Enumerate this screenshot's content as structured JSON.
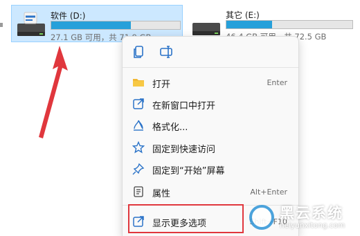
{
  "drives": [
    {
      "name": "软件 (D:)",
      "size_text": "27.1 GB 可用，共 71.9 GB",
      "used_fraction": 0.62
    },
    {
      "name": "其它 (E:)",
      "size_text": "46.4 GB 可用，共 72.5 GB",
      "used_fraction": 0.36
    }
  ],
  "context_menu": {
    "quick_actions": [
      "copy-icon",
      "rename-icon"
    ],
    "items": [
      {
        "label": "打开",
        "shortcut": "Enter",
        "icon": "folder-icon"
      },
      {
        "label": "在新窗口中打开",
        "shortcut": "",
        "icon": "open-new-window-icon"
      },
      {
        "label": "格式化...",
        "shortcut": "",
        "icon": "format-icon"
      },
      {
        "label": "固定到快速访问",
        "shortcut": "",
        "icon": "star-icon"
      },
      {
        "label": "固定到“开始”屏幕",
        "shortcut": "",
        "icon": "pin-icon"
      },
      {
        "label": "属性",
        "shortcut": "Alt+Enter",
        "icon": "properties-icon"
      },
      {
        "label": "显示更多选项",
        "shortcut": "Shift+F10",
        "icon": "more-options-icon"
      }
    ]
  },
  "watermark": {
    "title": "黑云系统",
    "url": "heiyunxitong.com"
  },
  "colors": {
    "selection": "#cce8ff",
    "bar_fill": "#26a0da",
    "arrow": "#e0373d",
    "highlight_border": "#e0373d",
    "icon_blue": "#2b73c8"
  }
}
